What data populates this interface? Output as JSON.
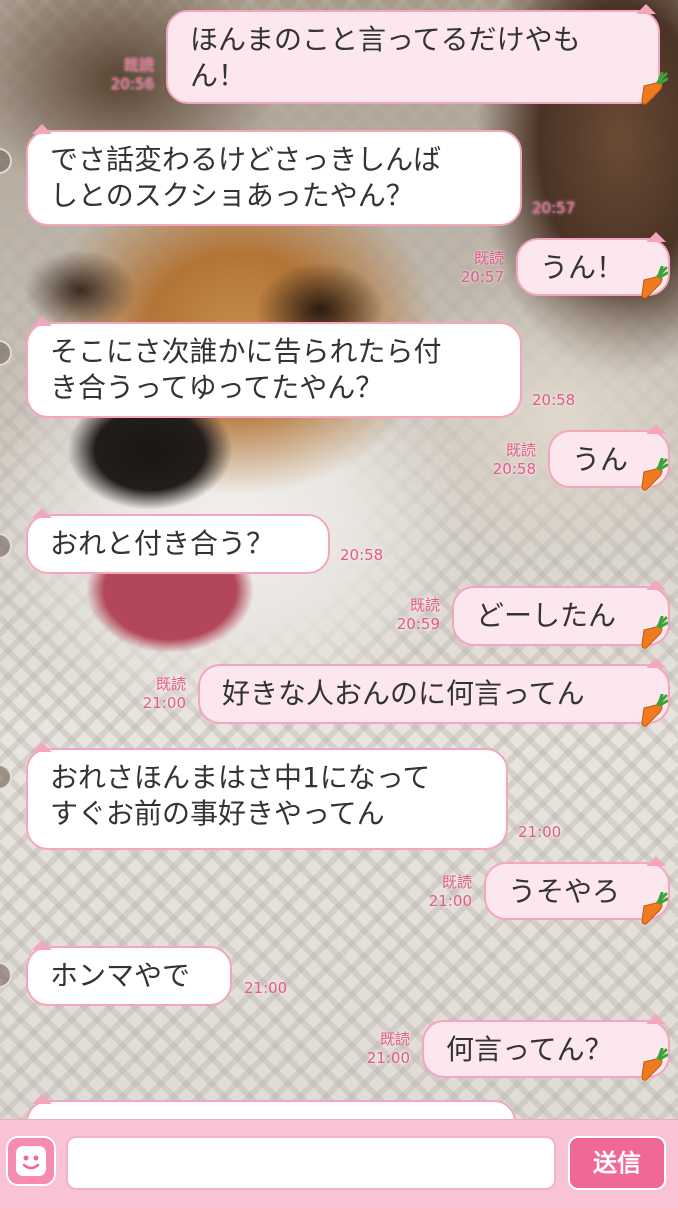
{
  "messages": [
    {
      "side": "sent",
      "text": "ほんまのこと言ってるだけやも\nん！",
      "read": "既読",
      "time": "20:56"
    },
    {
      "side": "recv",
      "text": "でさ話変わるけどさっきしんば\nしとのスクショあったやん？",
      "time": "20:57"
    },
    {
      "side": "sent",
      "text": "うん！",
      "read": "既読",
      "time": "20:57"
    },
    {
      "side": "recv",
      "text": "そこにさ次誰かに告られたら付\nき合うってゆってたやん？",
      "time": "20:58"
    },
    {
      "side": "sent",
      "text": "うん",
      "read": "既読",
      "time": "20:58"
    },
    {
      "side": "recv",
      "text": "おれと付き合う？",
      "time": "20:58"
    },
    {
      "side": "sent",
      "text": "どーしたん",
      "read": "既読",
      "time": "20:59"
    },
    {
      "side": "sent",
      "text": "好きな人おんのに何言ってん",
      "read": "既読",
      "time": "21:00"
    },
    {
      "side": "recv",
      "text": "おれさほんまはさ中1になって\nすぐお前の事好きやってん",
      "time": "21:00"
    },
    {
      "side": "sent",
      "text": "うそやろ",
      "read": "既読",
      "time": "21:00"
    },
    {
      "side": "recv",
      "text": "ホンマやで",
      "time": "21:00"
    },
    {
      "side": "sent",
      "text": "何言ってん？",
      "read": "既読",
      "time": "21:00"
    }
  ],
  "input": {
    "value": "",
    "send_label": "送信"
  },
  "icons": {
    "sticker": "carrot-icon",
    "emoji_button": "smiley-icon"
  },
  "colors": {
    "accent": "#f06896",
    "bubble_border": "#f3a6bd",
    "meta_text": "#e8588a",
    "input_bar": "#f9c3d3"
  }
}
